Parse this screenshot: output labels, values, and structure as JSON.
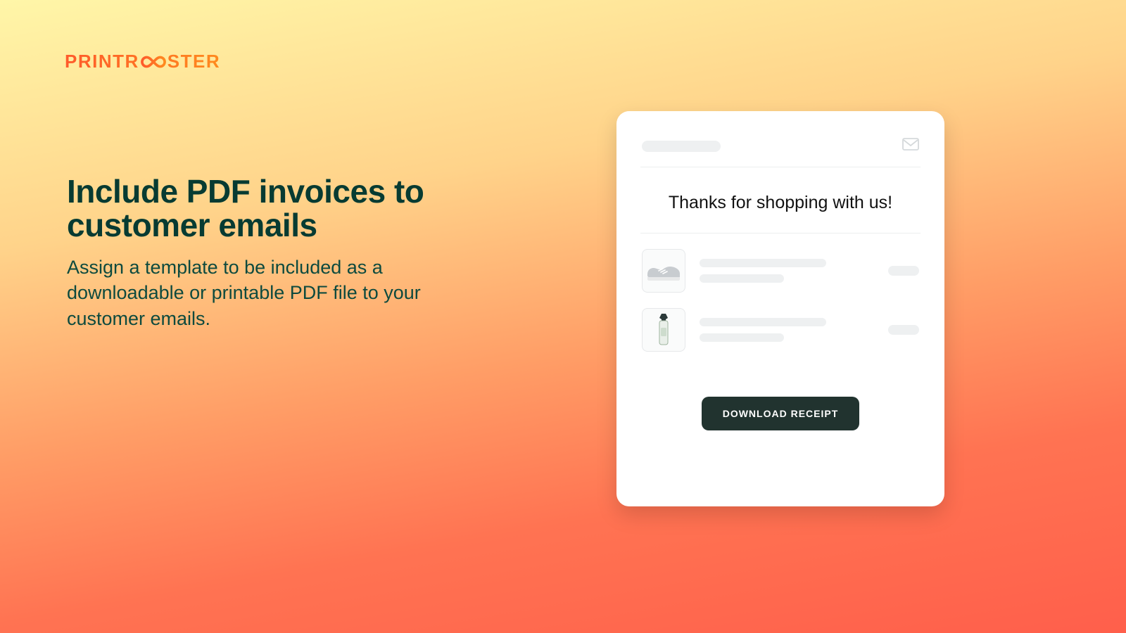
{
  "brand": {
    "name_pre": "PRINTR",
    "name_post": "STER"
  },
  "hero": {
    "title": "Include PDF invoices to customer emails",
    "subtitle": "Assign a template to be included as a downloadable or printable PDF file to your customer emails."
  },
  "email_card": {
    "thanks_text": "Thanks for shopping with us!",
    "download_button_label": "DOWNLOAD RECEIPT",
    "items": [
      {
        "icon": "sneaker-icon"
      },
      {
        "icon": "bottle-icon"
      }
    ]
  }
}
